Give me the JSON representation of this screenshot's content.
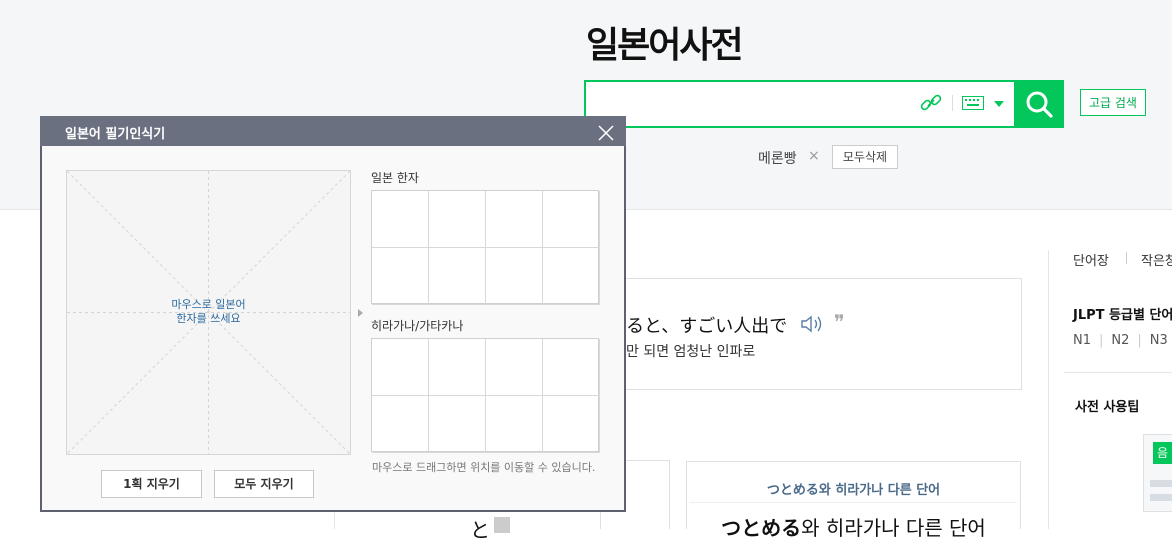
{
  "header": {
    "logo": "일본어사전",
    "search_value": "",
    "advanced_search_label": "고급 검색",
    "recent": {
      "word": "메론빵",
      "remove_glyph": "×",
      "clear_all_label": "모두삭제"
    },
    "icons": [
      "link-icon",
      "keyboard-icon",
      "dropdown-arrow-icon",
      "search-icon"
    ],
    "accent_color": "#03c75a"
  },
  "example": {
    "japanese": "ると、すごい人出で",
    "korean": "만 되면 엄청난 인파로",
    "quote_glyph": "❞"
  },
  "similar_card": {
    "title": "つとめる와 히라가나 다른 단어",
    "big_word_bold": "つとめる",
    "big_word_rest": "와 히라가나 다른 단어"
  },
  "partial_bottom_text": "と",
  "sidebar": {
    "tab_wordbook": "단어장",
    "tab_other": "작은창",
    "jlpt_title": "JLPT 등급별 단어",
    "levels": [
      "N1",
      "N2",
      "N3"
    ],
    "tips_title": "사전 사용팁",
    "thumb_label": "음"
  },
  "popup": {
    "title": "일본어 필기인식기",
    "draw_hint_line1": "마우스로 일본어",
    "draw_hint_line2": "한자를 쓰세요",
    "section_kanji": "일본 한자",
    "section_kana": "히라가나/가타카나",
    "drag_note": "마우스로 드래그하면 위치를 이동할 수 있습니다.",
    "btn_undo": "1획 지우기",
    "btn_clear": "모두 지우기"
  }
}
